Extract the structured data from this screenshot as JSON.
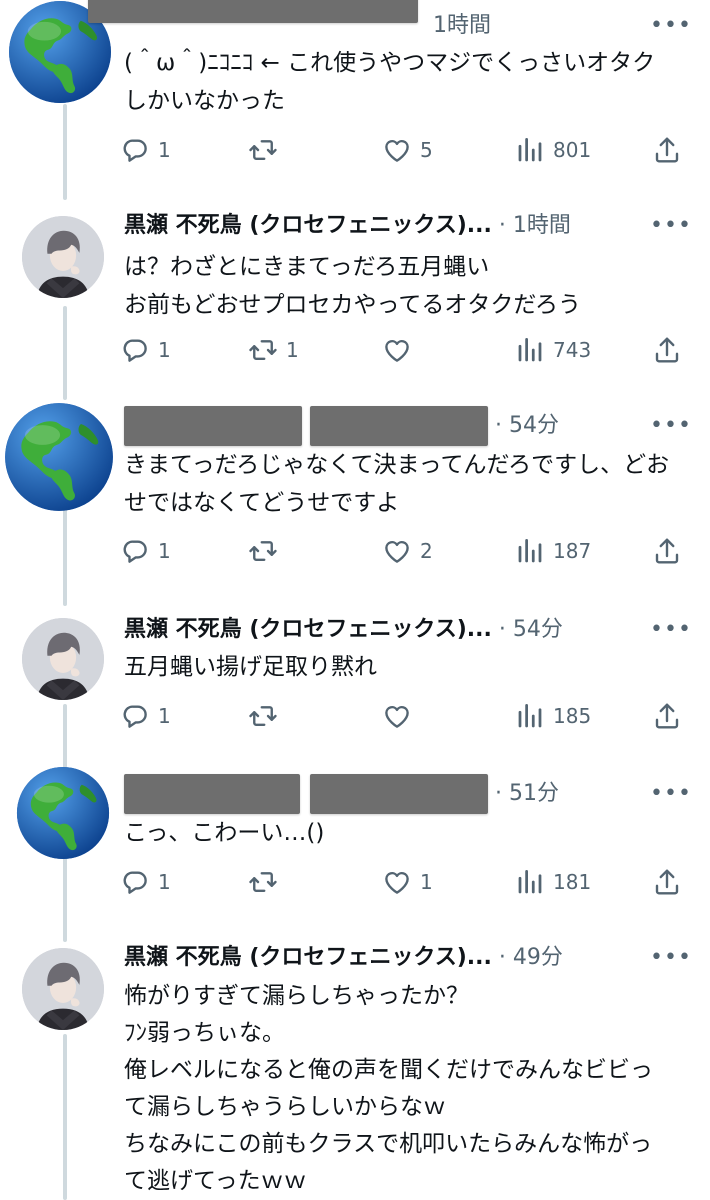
{
  "tweets": [
    {
      "author": "",
      "time": "1時間",
      "text": "(＾ω＾)ﾆｺﾆｺ ← これ使うやつマジでくっさいオタクしかいなかった",
      "replies": "1",
      "retweets": "",
      "likes": "5",
      "views": "801",
      "avatar": "globe"
    },
    {
      "author": "黒瀬 不死鳥 (クロセフェニックス)...",
      "time": "1時間",
      "text": "は？わざとにきまてっだろ五月蝿い\nお前もどおせプロセカやってるオタクだろう",
      "replies": "1",
      "retweets": "1",
      "likes": "",
      "views": "743",
      "avatar": "person"
    },
    {
      "author": "",
      "time": "54分",
      "text": "きまてっだろじゃなくて決まってんだろですし、どおせではなくてどうせですよ",
      "replies": "1",
      "retweets": "",
      "likes": "2",
      "views": "187",
      "avatar": "globe"
    },
    {
      "author": "黒瀬 不死鳥 (クロセフェニックス)...",
      "time": "54分",
      "text": "五月蝿い揚げ足取り黙れ",
      "replies": "1",
      "retweets": "",
      "likes": "",
      "views": "185",
      "avatar": "person"
    },
    {
      "author": "",
      "time": "51分",
      "text": "こっ、こわーい…()",
      "replies": "1",
      "retweets": "",
      "likes": "1",
      "views": "181",
      "avatar": "globe"
    },
    {
      "author": "黒瀬 不死鳥 (クロセフェニックス)...",
      "time": "49分",
      "text": "怖がりすぎて漏らしちゃったか？\nﾌﾝ弱っちぃな。\n俺レベルになると俺の声を聞くだけでみんなビビって漏らしちゃうらしいからなｗ\nちなみにこの前もクラスで机叩いたらみんな怖がって逃げてったｗｗ",
      "replies": "",
      "retweets": "",
      "likes": "",
      "views": "",
      "avatar": "person"
    }
  ],
  "icons": {
    "reply": "reply-icon",
    "retweet": "retweet-icon",
    "like": "heart-icon",
    "views": "views-icon",
    "share": "share-icon",
    "more": "more-icon"
  },
  "colors": {
    "icon_gray": "#536471",
    "text": "#0f1419",
    "thread_line": "#cfd9de",
    "redaction": "#6e6e6e"
  }
}
